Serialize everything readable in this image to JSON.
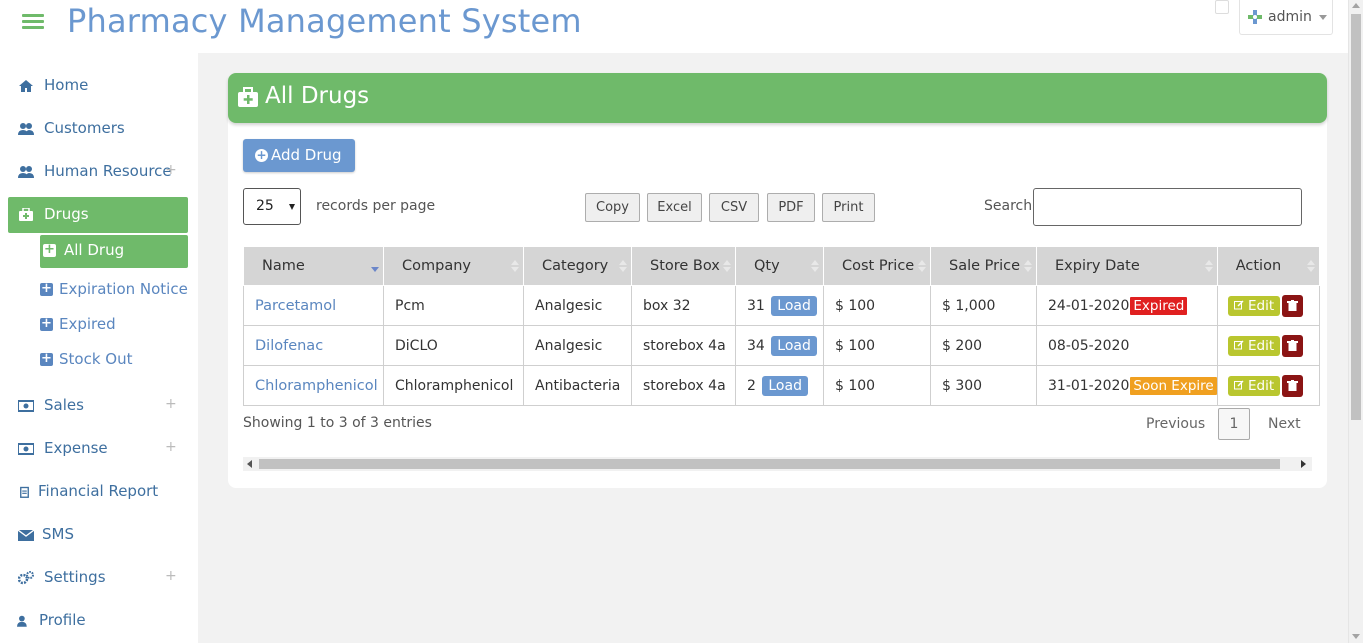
{
  "app": {
    "title": "Pharmacy Management System"
  },
  "header": {
    "user_name": "admin"
  },
  "sidebar": {
    "items": [
      {
        "label": "Home",
        "icon": "home-icon"
      },
      {
        "label": "Customers",
        "icon": "users-icon"
      },
      {
        "label": "Human Resource",
        "icon": "users-icon",
        "expand": "+"
      },
      {
        "label": "Drugs",
        "icon": "medkit-icon",
        "active": true
      },
      {
        "label": "Sales",
        "icon": "money-icon",
        "expand": "+"
      },
      {
        "label": "Expense",
        "icon": "money-icon",
        "expand": "+"
      },
      {
        "label": "Financial Report",
        "icon": "clipboard-icon"
      },
      {
        "label": "SMS",
        "icon": "envelope-icon"
      },
      {
        "label": "Settings",
        "icon": "cogs-icon",
        "expand": "+"
      },
      {
        "label": "Profile",
        "icon": "user-icon"
      }
    ],
    "subitems": [
      {
        "label": "All Drug",
        "active": true
      },
      {
        "label": "Expiration Notice"
      },
      {
        "label": "Expired"
      },
      {
        "label": "Stock Out"
      }
    ]
  },
  "panel": {
    "title": "All Drugs",
    "add_button": "Add Drug",
    "length": {
      "value": "25",
      "label": "records per page"
    },
    "export_buttons": [
      "Copy",
      "Excel",
      "CSV",
      "PDF",
      "Print"
    ],
    "search_label": "Search:",
    "search_value": ""
  },
  "table": {
    "columns": [
      "Name",
      "Company",
      "Category",
      "Store Box",
      "Qty",
      "Cost Price",
      "Sale Price",
      "Expiry Date",
      "Action"
    ],
    "rows": [
      {
        "name": "Parcetamol",
        "company": "Pcm",
        "category": "Analgesic",
        "store_box": "box 32",
        "qty": "31",
        "cost_price": "$ 100",
        "sale_price": "$ 1,000",
        "expiry_date": "24-01-2020",
        "status": "Expired"
      },
      {
        "name": "Dilofenac",
        "company": "DiCLO",
        "category": "Analgesic",
        "store_box": "storebox 4a",
        "qty": "34",
        "cost_price": "$ 100",
        "sale_price": "$ 200",
        "expiry_date": "08-05-2020",
        "status": ""
      },
      {
        "name": "Chloramphenicol",
        "company": "Chloramphenicol",
        "category": "Antibacteria",
        "store_box": "storebox 4a",
        "qty": "2",
        "cost_price": "$ 100",
        "sale_price": "$ 300",
        "expiry_date": "31-01-2020",
        "status": "Soon Expire"
      }
    ],
    "load_label": "Load",
    "edit_label": "Edit"
  },
  "footer": {
    "info": "Showing 1 to 3 of 3 entries",
    "previous": "Previous",
    "page": "1",
    "next": "Next"
  },
  "colors": {
    "accent_green": "#6fba6a",
    "accent_blue": "#6b98d0",
    "expired_red": "#e02020",
    "soon_orange": "#f0a020",
    "edit_olive": "#b9c62f",
    "delete_maroon": "#8b1414"
  }
}
